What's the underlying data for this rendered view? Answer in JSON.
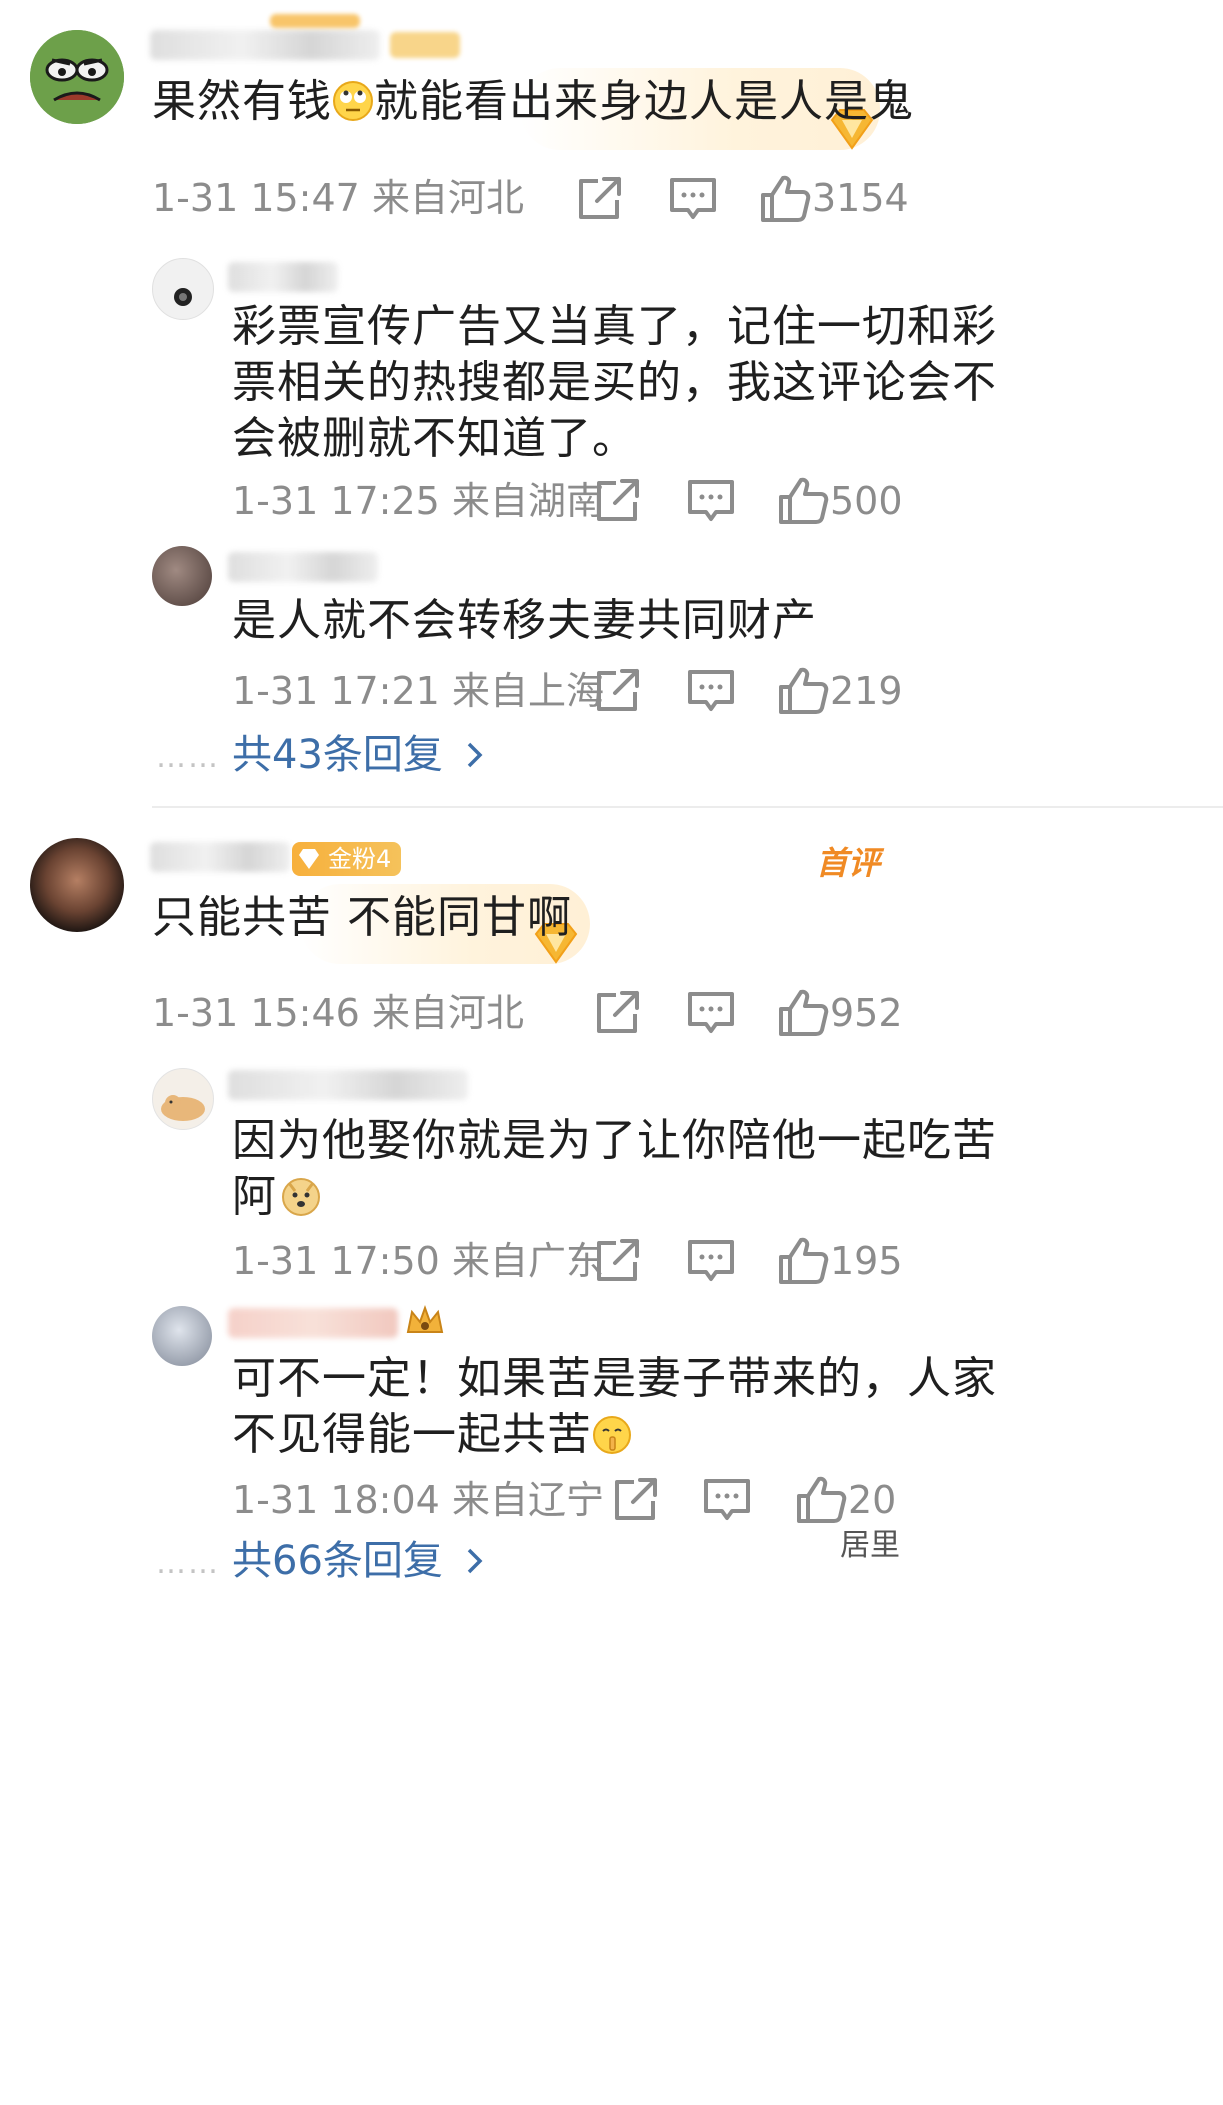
{
  "comments": [
    {
      "text_a": "果然有钱",
      "text_b": "就能看出来身边人是人是鬼",
      "time": "1-31 15:47",
      "location": "来自河北",
      "likes": "3154",
      "replies": [
        {
          "lines": [
            "彩票宣传广告又当真了，记住一切和彩",
            "票相关的热搜都是买的，我这评论会不",
            "会被删就不知道了。"
          ],
          "time": "1-31 17:25",
          "location": "来自湖南",
          "likes": "500"
        },
        {
          "lines": [
            "是人就不会转移夫妻共同财产"
          ],
          "time": "1-31 17:21",
          "location": "来自上海",
          "likes": "219"
        }
      ],
      "more": "共43条回复",
      "more_dots": "……"
    },
    {
      "badge": "金粉4",
      "first_tag": "首评",
      "text": "只能共苦 不能同甘啊",
      "time": "1-31 15:46",
      "location": "来自河北",
      "likes": "952",
      "replies": [
        {
          "lines": [
            "因为他娶你就是为了让你陪他一起吃苦",
            "阿"
          ],
          "time": "1-31 17:50",
          "location": "来自广东",
          "likes": "195"
        },
        {
          "lines": [
            "可不一定！如果苦是妻子带来的，人家",
            "不见得能一起共苦"
          ],
          "time": "1-31 18:04",
          "location": "来自辽宁",
          "likes": "20"
        }
      ],
      "more": "共66条回复",
      "more_dots": "……"
    }
  ],
  "watermark": "居里",
  "icons": [
    "repost-icon",
    "comment-icon",
    "like-icon",
    "chevron-right-icon",
    "fan-badge-icon",
    "emoji-eyeroll-icon",
    "emoji-doge-icon",
    "emoji-shush-icon"
  ],
  "colors": {
    "link": "#3d6ea8",
    "meta": "#8c8c8c",
    "badge": "#f7b03c",
    "first_tag": "#f08a24"
  }
}
